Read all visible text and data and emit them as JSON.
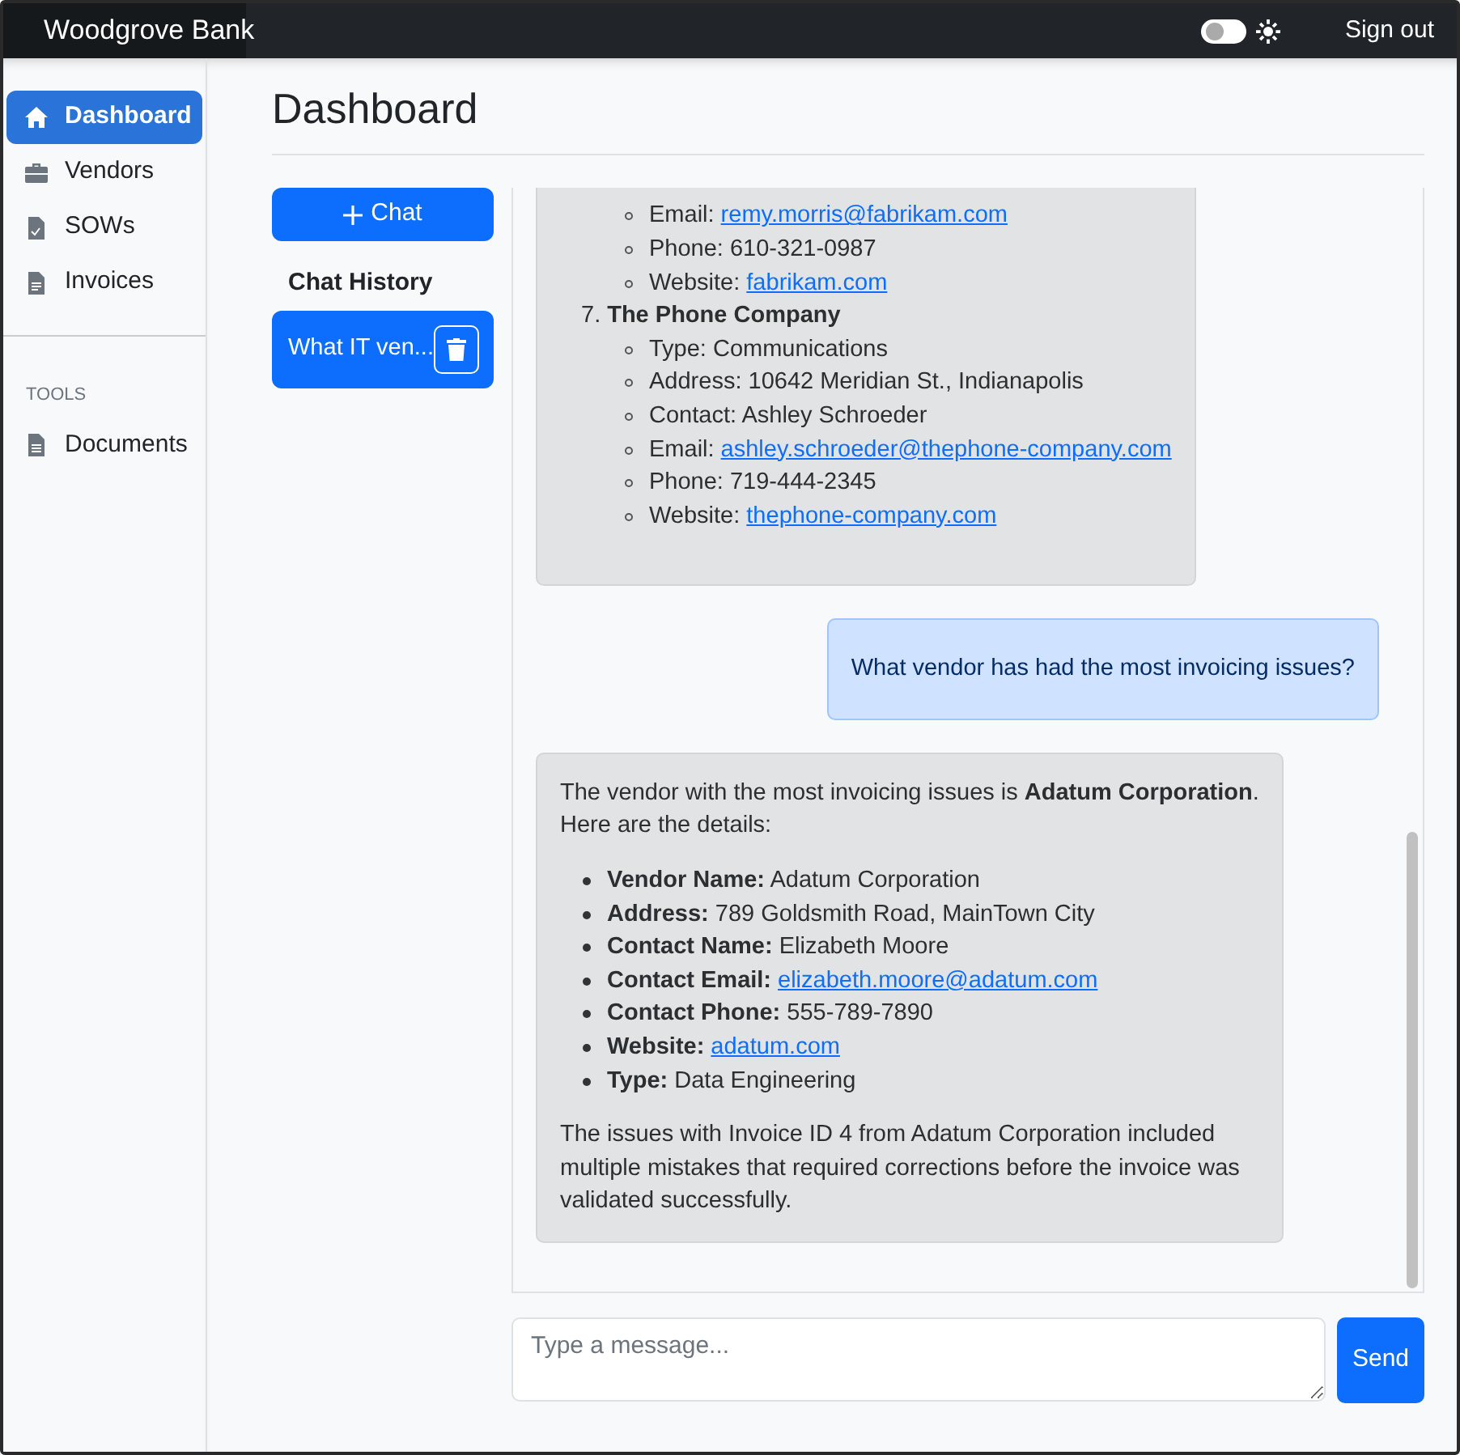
{
  "brand": {
    "name": "Woodgrove Bank"
  },
  "header": {
    "theme_toggle": {
      "on": false
    },
    "sign_out": "Sign out"
  },
  "sidebar": {
    "items": [
      {
        "label": "Dashboard",
        "kind": "home",
        "selected": true
      },
      {
        "label": "Vendors",
        "kind": "briefcase",
        "selected": false
      },
      {
        "label": "SOWs",
        "kind": "file",
        "selected": false
      },
      {
        "label": "Invoices",
        "kind": "invoice",
        "selected": false
      }
    ],
    "sections": [
      {
        "heading": "TOOLS",
        "items": [
          {
            "label": "Documents",
            "kind": "document",
            "selected": false
          }
        ]
      }
    ]
  },
  "page_title": "Dashboard",
  "chat_panel": {
    "new_chat_button": "Chat",
    "history_heading": "Chat History",
    "history": [
      {
        "label": "What IT ven...",
        "selected": true
      }
    ]
  },
  "messages": [
    {
      "kind": "assistant",
      "blocks": [
        {
          "kind": "sublist",
          "items": [
            {
              "text": "Email:",
              "link": "remy.morris@fabrikam.com"
            },
            {
              "text": "Phone: 610-321-0987"
            },
            {
              "text": "Website:",
              "link": "fabrikam.com"
            }
          ]
        },
        {
          "kind": "numbered",
          "number": "7.",
          "title": "The Phone Company",
          "items": [
            {
              "text": "Type: Communications"
            },
            {
              "text": "Address: 10642 Meridian St., Indianapolis"
            },
            {
              "text": "Contact: Ashley Schroeder"
            },
            {
              "text": "Email:",
              "link": "ashley.schroeder@thephone-company.com"
            },
            {
              "text": "Phone: 719-444-2345"
            },
            {
              "text": "Website:",
              "link": "thephone-company.com"
            }
          ]
        }
      ]
    },
    {
      "kind": "user",
      "blocks": [
        {
          "kind": "paragraph",
          "text": "What vendor has had the most invoicing issues?"
        }
      ]
    },
    {
      "kind": "assistant",
      "blocks": [
        {
          "kind": "paragraph",
          "text": "The vendor with the most invoicing issues is **Adatum Corporation**. Here are the details:"
        },
        {
          "kind": "bullets",
          "items": [
            {
              "text": "**Vendor Name:** Adatum Corporation"
            },
            {
              "text": "**Address:** 789 Goldsmith Road, MainTown City"
            },
            {
              "text": "**Contact Name:** Elizabeth Moore"
            },
            {
              "text": "**Contact Email:**",
              "link": "elizabeth.moore@adatum.com"
            },
            {
              "text": "**Contact Phone:** 555-789-7890"
            },
            {
              "text": "**Website:**",
              "link": "adatum.com"
            },
            {
              "text": "**Type:** Data Engineering"
            }
          ]
        },
        {
          "kind": "paragraph",
          "text": "The issues with Invoice ID 4 from Adatum Corporation included multiple mistakes that required corrections before the invoice was validated successfully."
        }
      ]
    }
  ],
  "composer": {
    "placeholder": "Type a message...",
    "send_button": "Send"
  }
}
